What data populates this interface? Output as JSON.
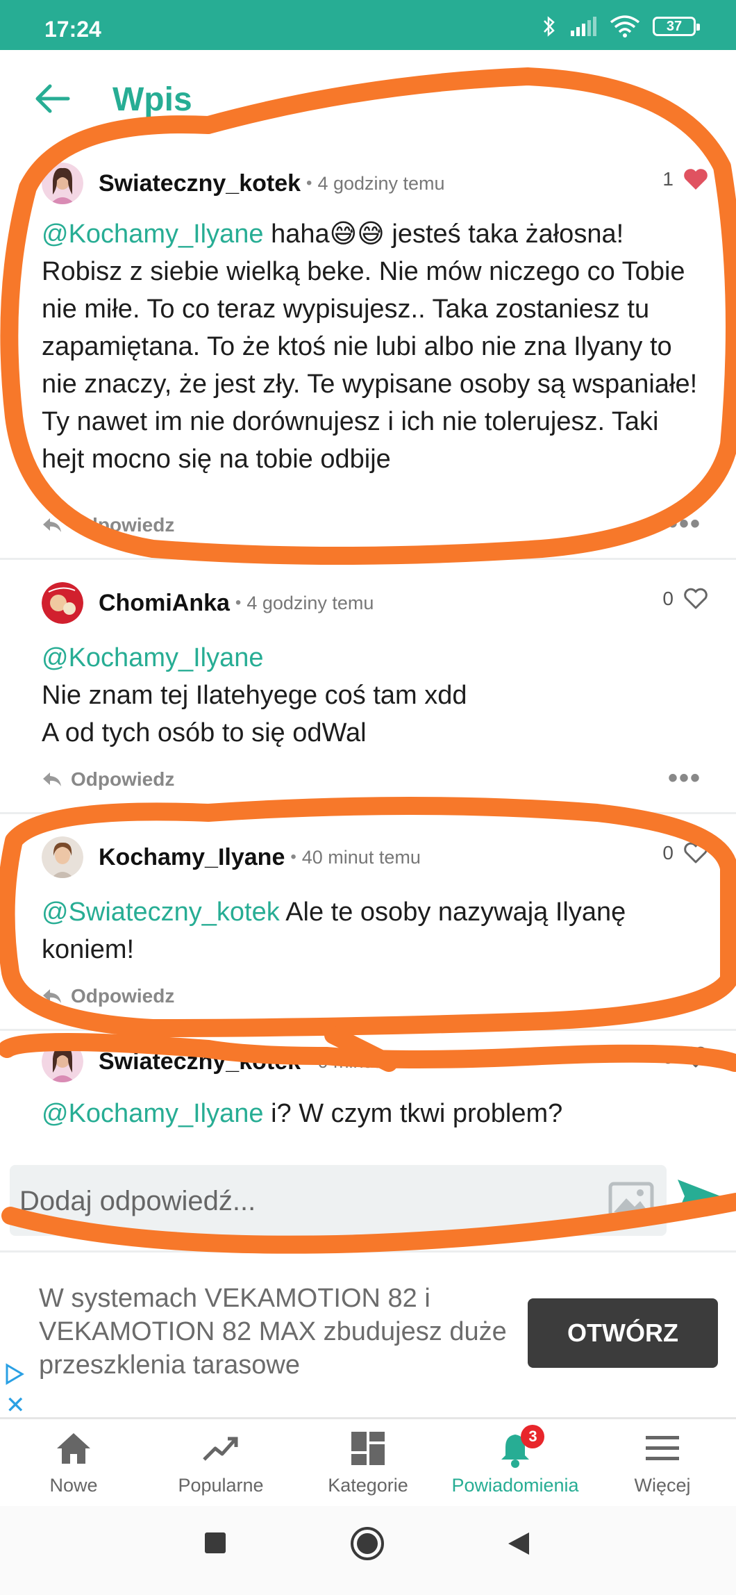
{
  "status_bar": {
    "time": "17:24",
    "battery": "37"
  },
  "header": {
    "title": "Wpis"
  },
  "comments": [
    {
      "username": "Swiateczny_kotek",
      "time": "4 godziny temu",
      "likes": "1",
      "mention": "@Kochamy_Ilyane",
      "text": " haha😅😅 jesteś taka żałosna! Robisz z siebie wielką beke. Nie mów niczego co Tobie nie miłe. To co teraz wypisujesz.. Taka zostaniesz tu zapamiętana. To że ktoś nie lubi albo nie zna Ilyany to nie znaczy, że jest zły. Te wypisane osoby są wspaniałe! Ty nawet im nie dorównujesz i ich nie tolerujesz. Taki hejt mocno się na tobie odbije",
      "reply_label": "Odpowiedz"
    },
    {
      "username": "ChomiAnka",
      "time": "4 godziny temu",
      "likes": "0",
      "mention": "@Kochamy_Ilyane",
      "text": "Nie znam tej Ilatehyege coś tam xdd A od tych osób to się odWal",
      "reply_label": "Odpowiedz"
    },
    {
      "username": "Kochamy_Ilyane",
      "time": "40 minut temu",
      "likes": "0",
      "mention": "@Swiateczny_kotek",
      "text": " Ale te osoby nazywają Ilyanę koniem!",
      "reply_label": "Odpowiedz"
    },
    {
      "username": "Swiateczny_kotek",
      "time": "0 minut temu",
      "likes": "0",
      "mention": "@Kochamy_Ilyane",
      "text": " i? W czym tkwi problem?"
    }
  ],
  "reply_input": {
    "placeholder": "Dodaj odpowiedź..."
  },
  "ad": {
    "text": "W systemach VEKAMOTION 82 i VEKAMOTION 82 MAX zbudujesz duże przeszklenia tarasowe",
    "button": "OTWÓRZ"
  },
  "bottom_nav": [
    {
      "label": "Nowe",
      "icon": "home-icon"
    },
    {
      "label": "Popularne",
      "icon": "trending-icon"
    },
    {
      "label": "Kategorie",
      "icon": "grid-icon"
    },
    {
      "label": "Powiadomienia",
      "icon": "bell-icon",
      "badge": "3",
      "active": true
    },
    {
      "label": "Więcej",
      "icon": "menu-icon"
    }
  ],
  "colors": {
    "accent": "#27ad94",
    "like_red": "#e05260",
    "badge_red": "#e8262b",
    "scribble_orange": "#f7782a"
  }
}
